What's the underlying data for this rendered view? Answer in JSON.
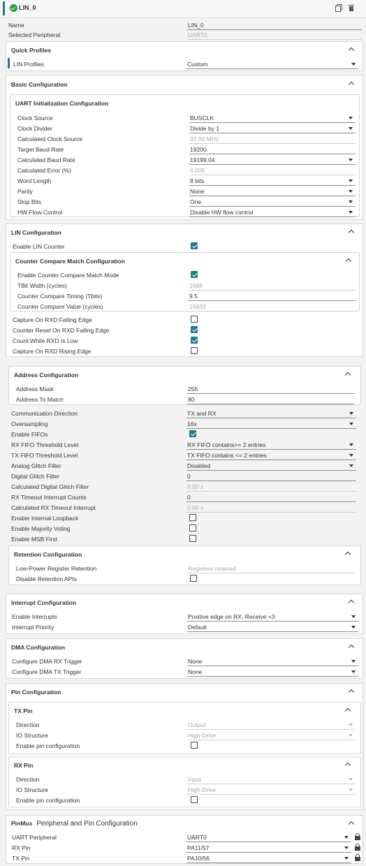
{
  "header": {
    "title": "LIN_0",
    "copy_icon": "copy-icon",
    "delete_icon": "trash-icon",
    "status_icon": "check-circle-icon",
    "accent": "#1f7a8c",
    "status_color": "#2e9a3e"
  },
  "top": {
    "name_label": "Name",
    "name_value": "LIN_0",
    "peripheral_label": "Selected Peripheral",
    "peripheral_value": "UART0"
  },
  "quick_profiles": {
    "title": "Quick Profiles",
    "lin_profiles_label": "LIN Profiles",
    "lin_profiles_value": "Custom"
  },
  "basic": {
    "title": "Basic Configuration",
    "uart_init": {
      "title": "UART Initialization Configuration",
      "rows": [
        {
          "label": "Clock Source",
          "value": "BUSCLK",
          "kind": "select"
        },
        {
          "label": "Clock Divider",
          "value": "Divide by 1",
          "kind": "select"
        },
        {
          "label": "Calculated Clock Source",
          "value": "32.00 MHz",
          "kind": "readonly"
        },
        {
          "label": "Target Baud Rate",
          "value": "19200",
          "kind": "input"
        },
        {
          "label": "Calculated Baud Rate",
          "value": "19199.04",
          "kind": "select"
        },
        {
          "label": "Calculated Error (%)",
          "value": "0.005",
          "kind": "readonly"
        },
        {
          "label": "Word Length",
          "value": "8 bits",
          "kind": "select"
        },
        {
          "label": "Parity",
          "value": "None",
          "kind": "select"
        },
        {
          "label": "Stop Bits",
          "value": "One",
          "kind": "select"
        },
        {
          "label": "HW Flow Control",
          "value": "Disable HW flow control",
          "kind": "select"
        }
      ]
    }
  },
  "lin": {
    "title": "LIN Configuration",
    "enable_counter_label": "Enable LIN Counter",
    "enable_counter": true,
    "ccm": {
      "title": "Counter Compare Match Configuration",
      "enable_label": "Enable Counter Compare Match Mode",
      "enable": true,
      "rows": [
        {
          "label": "TBit Width (cycles)",
          "value": "1666",
          "kind": "readonly"
        },
        {
          "label": "Counter Compare Timing (Tbits)",
          "value": "9.5",
          "kind": "input"
        },
        {
          "label": "Counter Compare Value (cycles)",
          "value": "15833",
          "kind": "readonly"
        }
      ]
    },
    "checks": [
      {
        "label": "Capture On RXD Falling Edge",
        "checked": false
      },
      {
        "label": "Counter Reset On RXD Falling Edge",
        "checked": true
      },
      {
        "label": "Count While RXD Is Low",
        "checked": true
      },
      {
        "label": "Capture On RXD Rising Edge",
        "checked": false
      }
    ]
  },
  "address": {
    "title": "Address Configuration",
    "rows": [
      {
        "label": "Address Mask",
        "value": "255"
      },
      {
        "label": "Address To Match",
        "value": "80"
      }
    ]
  },
  "advanced": {
    "rows": [
      {
        "label": "Communication Direction",
        "value": "TX and RX",
        "kind": "select"
      },
      {
        "label": "Oversampling",
        "value": "16x",
        "kind": "select"
      },
      {
        "label": "Enable FIFOs",
        "value": "",
        "kind": "check",
        "checked": true
      },
      {
        "label": "RX FIFO Threshold Level",
        "value": "RX FIFO contains>= 2 entries",
        "kind": "select"
      },
      {
        "label": "TX FIFO Threshold Level",
        "value": "TX FIFO contains <= 2 entries",
        "kind": "select"
      },
      {
        "label": "Analog Glitch Filter",
        "value": "Disabled",
        "kind": "select"
      },
      {
        "label": "Digital Glitch Filter",
        "value": "0",
        "kind": "input"
      },
      {
        "label": "Calculated Digital Glitch Filter",
        "value": "0.00 s",
        "kind": "readonly"
      },
      {
        "label": "RX Timeout Interrupt Counts",
        "value": "0",
        "kind": "input"
      },
      {
        "label": "Calculated RX Timeout Interrupt",
        "value": "0.00 s",
        "kind": "readonly"
      },
      {
        "label": "Enable Internal Loopback",
        "value": "",
        "kind": "check",
        "checked": false
      },
      {
        "label": "Enable Majority Voting",
        "value": "",
        "kind": "check",
        "checked": false
      },
      {
        "label": "Enable MSB First",
        "value": "",
        "kind": "check",
        "checked": false
      }
    ]
  },
  "retention": {
    "title": "Retention Configuration",
    "low_power_label": "Low-Power Register Retention",
    "low_power_value": "Registers retained",
    "disable_label": "Disable Retention APIs",
    "disable": false
  },
  "interrupt": {
    "title": "Interrupt Configuration",
    "enable_label": "Enable Interrupts",
    "enable_value": "Positive edge on RX, Receive +3",
    "priority_label": "Interrupt Priority",
    "priority_value": "Default"
  },
  "dma": {
    "title": "DMA Configuration",
    "rx_label": "Configure DMA RX Trigger",
    "rx_value": "None",
    "tx_label": "Configure DMA TX Trigger",
    "tx_value": "None"
  },
  "pin": {
    "title": "Pin Configuration",
    "tx": {
      "title": "TX Pin",
      "direction_label": "Direction",
      "direction_value": "Output",
      "io_label": "IO Structure",
      "io_value": "High-Drive",
      "enable_label": "Enable pin configuration",
      "enable": false
    },
    "rx": {
      "title": "RX Pin",
      "direction_label": "Direction",
      "direction_value": "Input",
      "io_label": "IO Structure",
      "io_value": "High-Drive",
      "enable_label": "Enable pin configuration",
      "enable": false
    }
  },
  "pinmux": {
    "title": "PinMux",
    "subtitle": "Peripheral and Pin Configuration",
    "rows": [
      {
        "label": "UART Peripheral",
        "value": "UART0"
      },
      {
        "label": "RX Pin",
        "value": "PA11/57"
      },
      {
        "label": "TX Pin",
        "value": "PA10/56"
      }
    ]
  }
}
